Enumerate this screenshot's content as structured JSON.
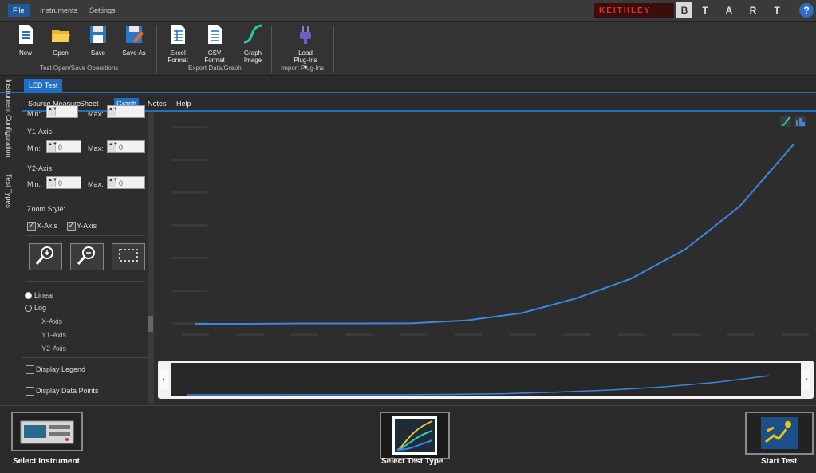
{
  "menu": {
    "tabs": [
      "File",
      "Instruments",
      "Settings"
    ]
  },
  "tart": [
    "B",
    "T",
    "A",
    "R",
    "T"
  ],
  "help_label": "?",
  "ribbon": {
    "buttons": [
      {
        "label": "New",
        "icon": "new-file-icon"
      },
      {
        "label": "Open",
        "icon": "open-folder-icon"
      },
      {
        "label": "Save",
        "icon": "save-icon"
      },
      {
        "label": "Save As",
        "icon": "save-as-icon"
      },
      {
        "label": "Excel Format",
        "icon": "excel-format-icon"
      },
      {
        "label": "CSV Format",
        "icon": "csv-format-icon"
      },
      {
        "label": "Graph Image",
        "icon": "graph-image-icon"
      },
      {
        "label": "Load Plug-Ins ▾",
        "icon": "plugin-icon"
      }
    ],
    "groups": [
      "Test Open/Save Operations",
      "Export Data/Graph",
      "Import Plug-Ins"
    ]
  },
  "doc_tab": "LED Test",
  "side_tabs": [
    "Instrument Configuration",
    "Test Types"
  ],
  "submenu": [
    "Source Measure",
    "Sheet",
    "Graph",
    "Notes",
    "Help"
  ],
  "submenu_active": "Graph",
  "panel": {
    "x_min_label": "Min:",
    "x_max_label": "Max:",
    "y1_label": "Y1-Axis:",
    "y2_label": "Y2-Axis:",
    "min_label": "Min:",
    "max_label": "Max:",
    "y1_min": "0",
    "y1_max": "0",
    "y2_min": "0",
    "y2_max": "0",
    "zoom_style": "Zoom Style:",
    "zoom_x": "X-Axis",
    "zoom_y": "Y-Axis",
    "linear": "Linear",
    "log": "Log",
    "log_x": "X-Axis",
    "log_y1": "Y1-Axis",
    "log_y2": "Y2-Axis",
    "display_legend": "Display Legend",
    "display_points": "Display Data Points"
  },
  "colors": {
    "accent": "#1f6fc6",
    "curve": "#3a86e0"
  },
  "bottom": {
    "select_instrument": "Select Instrument",
    "select_test_type": "Select Test Type",
    "start_test": "Start Test"
  },
  "chart_data": {
    "type": "line",
    "series": [
      {
        "values": [
          0.0,
          0.0,
          0.02,
          0.02,
          0.03,
          0.18,
          0.55,
          1.3,
          2.3,
          3.8,
          6.0,
          9.2
        ]
      }
    ],
    "x_index": [
      0,
      1,
      2,
      3,
      4,
      5,
      6,
      7,
      8,
      9,
      10,
      11
    ],
    "ylim": [
      0,
      10
    ],
    "grid": false
  }
}
